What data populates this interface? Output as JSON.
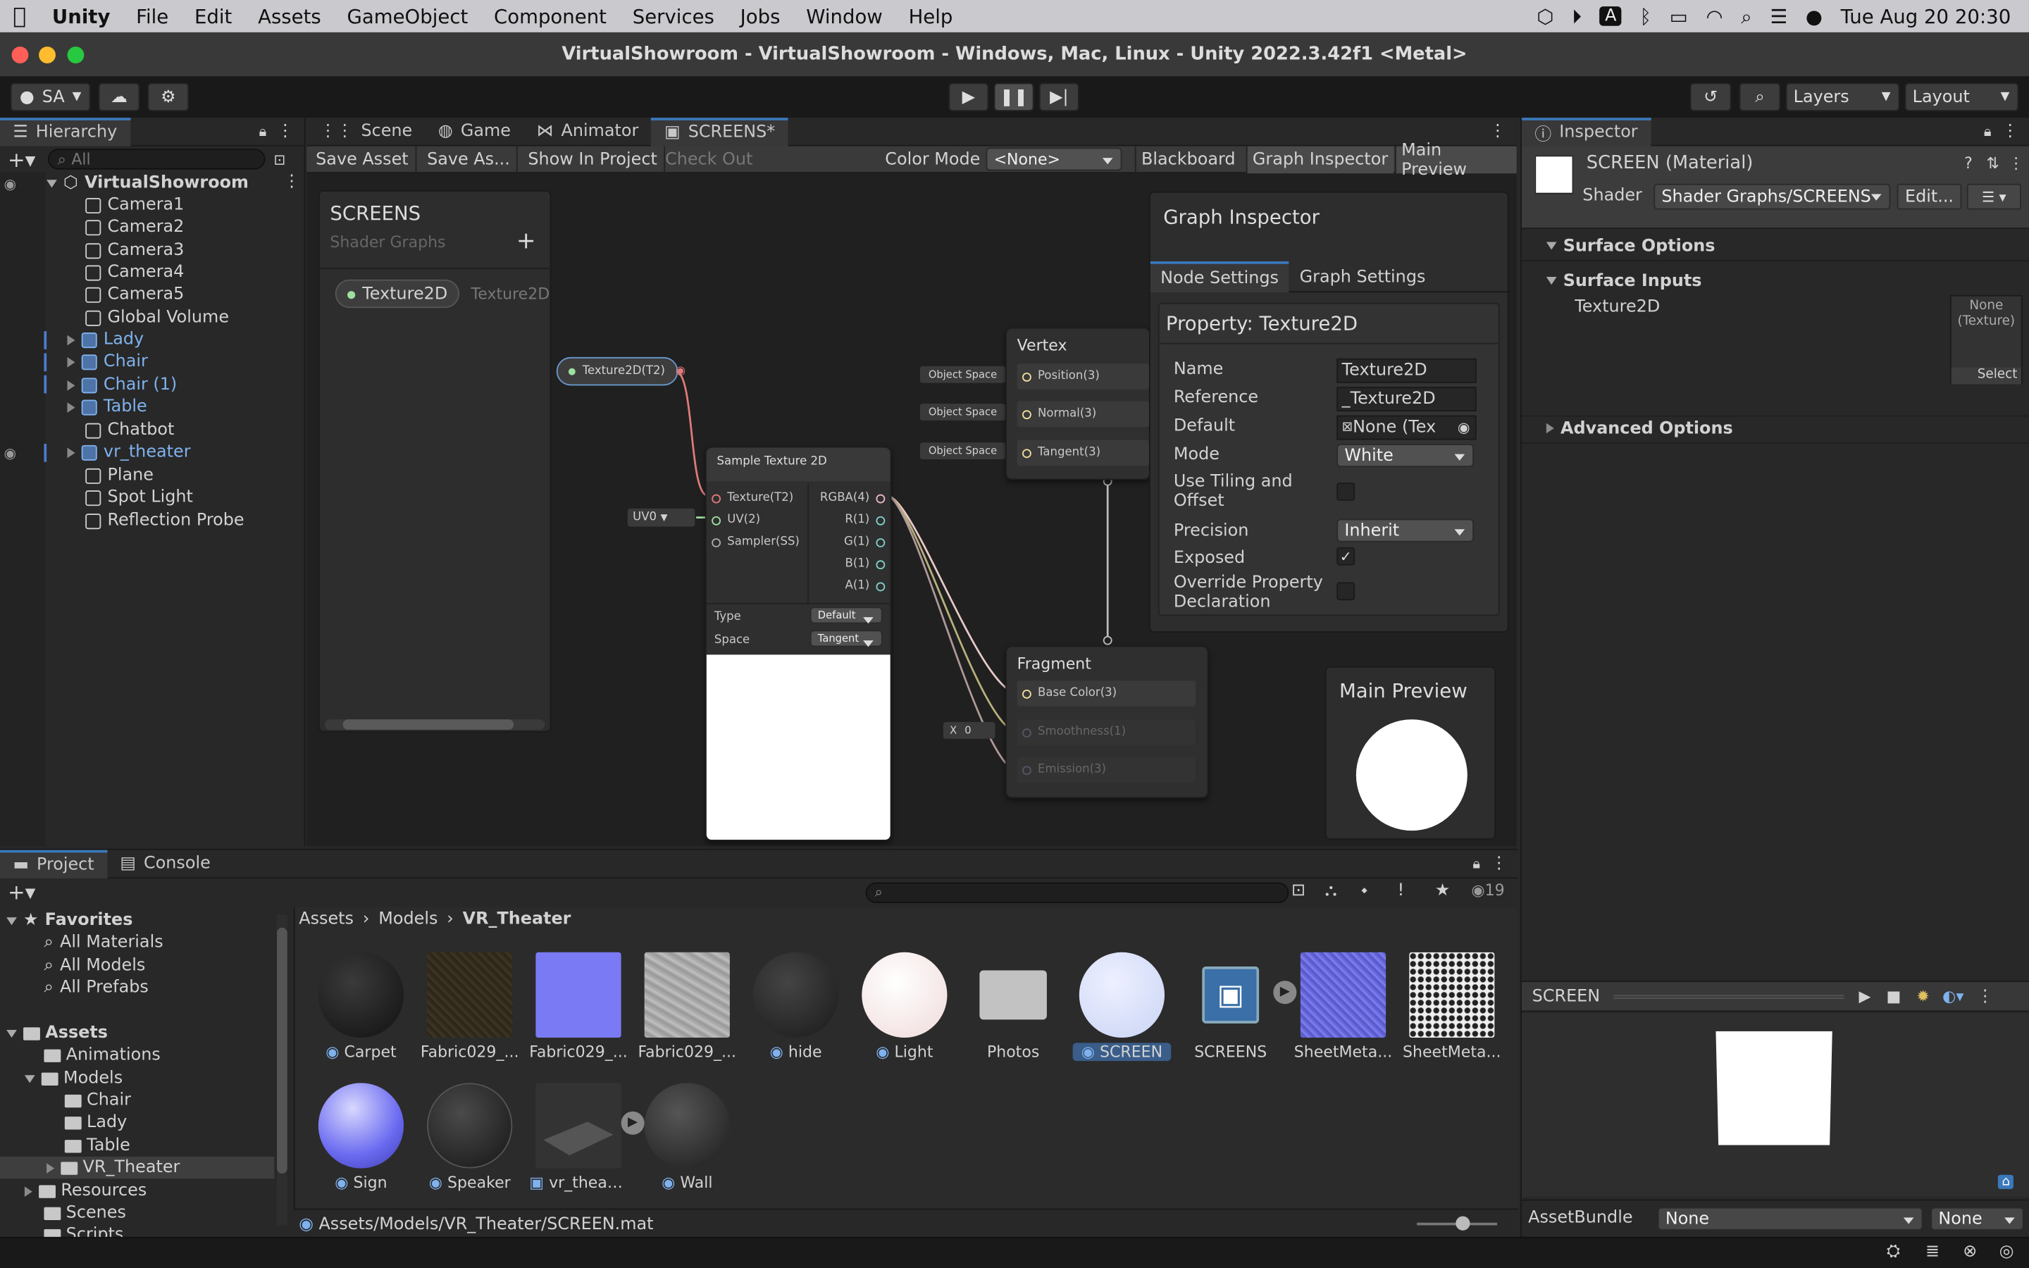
{
  "macbar": {
    "app": "Unity",
    "menus": [
      "File",
      "Edit",
      "Assets",
      "GameObject",
      "Component",
      "Services",
      "Jobs",
      "Window",
      "Help"
    ],
    "clock": "Tue Aug 20  20:30",
    "input_letter": "A"
  },
  "window": {
    "title": "VirtualShowroom - VirtualShowroom - Windows, Mac, Linux - Unity 2022.3.42f1 <Metal>"
  },
  "toolbar": {
    "account": "SA",
    "layers": "Layers",
    "layout": "Layout"
  },
  "hierarchy": {
    "tab": "Hierarchy",
    "search_placeholder": "All",
    "scene": "VirtualShowroom",
    "items": [
      {
        "label": "Camera1"
      },
      {
        "label": "Camera2"
      },
      {
        "label": "Camera3"
      },
      {
        "label": "Camera4"
      },
      {
        "label": "Camera5"
      },
      {
        "label": "Global Volume"
      },
      {
        "label": "Lady"
      },
      {
        "label": "Chair"
      },
      {
        "label": "Chair (1)"
      },
      {
        "label": "Table"
      },
      {
        "label": "Chatbot"
      },
      {
        "label": "vr_theater"
      },
      {
        "label": "Plane"
      },
      {
        "label": "Spot Light"
      },
      {
        "label": "Reflection Probe"
      }
    ]
  },
  "center_tabs": [
    "Scene",
    "Game",
    "Animator",
    "SCREENS*"
  ],
  "graph_toolbar": {
    "save": "Save Asset",
    "save_as": "Save As...",
    "show": "Show In Project",
    "checkout": "Check Out",
    "color_mode_label": "Color Mode",
    "color_mode_value": "<None>",
    "blackboard": "Blackboard",
    "graph_inspector": "Graph Inspector",
    "main_preview": "Main Preview"
  },
  "blackboard": {
    "title": "SCREENS",
    "subtitle": "Shader Graphs",
    "property": "Texture2D",
    "property_type": "Texture2D"
  },
  "nodes": {
    "prop_node": "Texture2D(T2)",
    "sample": {
      "title": "Sample Texture 2D",
      "in": [
        "Texture(T2)",
        "UV(2)",
        "Sampler(SS)"
      ],
      "out": [
        "RGBA(4)",
        "R(1)",
        "G(1)",
        "B(1)",
        "A(1)"
      ],
      "type_label": "Type",
      "type_value": "Default",
      "space_label": "Space",
      "space_value": "Tangent"
    },
    "uv": "UV0",
    "vertex": {
      "title": "Vertex",
      "slots": [
        "Position(3)",
        "Normal(3)",
        "Tangent(3)"
      ],
      "space": "Object Space"
    },
    "fragment": {
      "title": "Fragment",
      "slots": [
        "Base Color(3)",
        "Smoothness(1)",
        "Emission(3)"
      ]
    },
    "x_label": "X",
    "x_value": "0"
  },
  "graph_inspector": {
    "title": "Graph Inspector",
    "tab_node": "Node Settings",
    "tab_graph": "Graph Settings",
    "property_title": "Property: Texture2D",
    "name_label": "Name",
    "name_value": "Texture2D",
    "ref_label": "Reference",
    "ref_value": "_Texture2D",
    "default_label": "Default",
    "default_value": "None (Tex",
    "mode_label": "Mode",
    "mode_value": "White",
    "tiling_label": "Use Tiling and Offset",
    "precision_label": "Precision",
    "precision_value": "Inherit",
    "exposed_label": "Exposed",
    "override_label": "Override Property Declaration"
  },
  "main_preview": {
    "title": "Main Preview"
  },
  "inspector": {
    "tab": "Inspector",
    "material": "SCREEN (Material)",
    "shader_label": "Shader",
    "shader_value": "Shader Graphs/SCREENS",
    "edit": "Edit...",
    "surface_options": "Surface Options",
    "surface_inputs": "Surface Inputs",
    "texture_label": "Texture2D",
    "texture_none": "None (Texture)",
    "select": "Select",
    "advanced": "Advanced Options",
    "preview_name": "SCREEN",
    "assetbundle_label": "AssetBundle",
    "assetbundle_value": "None",
    "assetbundle_variant": "None"
  },
  "project": {
    "tab_project": "Project",
    "tab_console": "Console",
    "count": "19",
    "favorites": "Favorites",
    "fav_items": [
      "All Materials",
      "All Models",
      "All Prefabs"
    ],
    "assets": "Assets",
    "tree": [
      "Animations",
      "Models",
      "Chair",
      "Lady",
      "Table",
      "VR_Theater",
      "Resources",
      "Scenes",
      "Scripts"
    ],
    "breadcrumb": [
      "Assets",
      "Models",
      "VR_Theater"
    ],
    "grid": [
      {
        "label": "Carpet"
      },
      {
        "label": "Fabric029_..."
      },
      {
        "label": "Fabric029_..."
      },
      {
        "label": "Fabric029_..."
      },
      {
        "label": "hide"
      },
      {
        "label": "Light"
      },
      {
        "label": "Photos"
      },
      {
        "label": "SCREEN"
      },
      {
        "label": "SCREENS"
      },
      {
        "label": "SheetMeta..."
      },
      {
        "label": "SheetMeta..."
      },
      {
        "label": "Sign"
      },
      {
        "label": "Speaker"
      },
      {
        "label": "vr_theater"
      },
      {
        "label": "Wall"
      }
    ],
    "path": "Assets/Models/VR_Theater/SCREEN.mat"
  }
}
